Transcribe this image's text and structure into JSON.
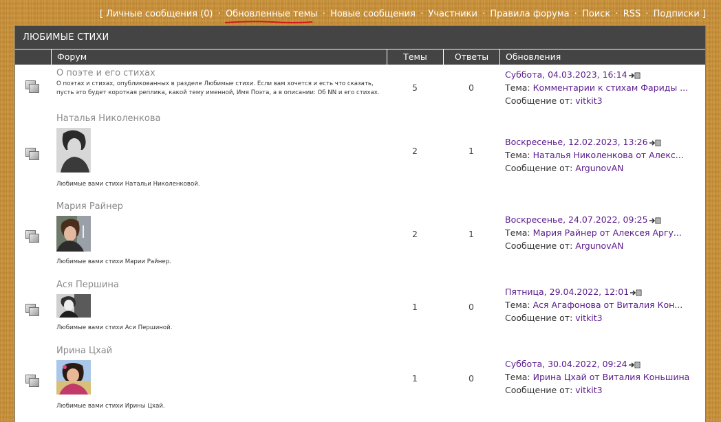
{
  "topnav": {
    "bracket_open": "[",
    "bracket_close": "]",
    "private_messages": "Личные сообщения (0)",
    "updated_topics": "Обновленные темы",
    "new_messages": "Новые сообщения",
    "members": "Участники",
    "rules": "Правила форума",
    "search": "Поиск",
    "rss": "RSS",
    "subscriptions": "Подписки",
    "separator": "·"
  },
  "panel": {
    "title": "ЛЮБИМЫЕ СТИХИ",
    "columns": {
      "forum": "Форум",
      "topics": "Темы",
      "replies": "Ответы",
      "updates": "Обновления"
    }
  },
  "labels": {
    "topic_prefix": "Тема:",
    "message_prefix": "Сообщение от:"
  },
  "rows": [
    {
      "title": "О поэте и его стихах",
      "desc": "О поэтах и стихах, опубликованных в разделе Любимые стихи. Если вам хочется и есть что сказать, пусть это будет короткая реплика, какой тему именной, Имя Поэта, а в описании: Об NN и его стихах.",
      "topics": "5",
      "replies": "0",
      "date": "Суббота, 04.03.2023, 16:14",
      "topic": "Комментарии к стихам Фариды ...",
      "author": "vitkit3"
    },
    {
      "title": "Наталья Николенкова",
      "desc": "Любимые вами стихи Натальи Николенковой.",
      "topics": "2",
      "replies": "1",
      "date": "Воскресенье, 12.02.2023, 13:26",
      "topic": "Наталья Николенкова от Алекс...",
      "author": "ArgunovAN"
    },
    {
      "title": "Мария Райнер",
      "desc": "Любимые вами стихи Марии Райнер.",
      "topics": "2",
      "replies": "1",
      "date": "Воскресенье, 24.07.2022, 09:25",
      "topic": "Мария Райнер от Алексея Аргу...",
      "author": "ArgunovAN"
    },
    {
      "title": "Ася Першина",
      "desc": "Любимые вами стихи Аси Першиной.",
      "topics": "1",
      "replies": "0",
      "date": "Пятница, 29.04.2022, 12:01",
      "topic": "Ася Агафонова от Виталия Кон...",
      "author": "vitkit3"
    },
    {
      "title": "Ирина Цхай",
      "desc": "Любимые вами стихи Ирины Цхай.",
      "topics": "1",
      "replies": "0",
      "date": "Суббота, 30.04.2022, 09:24",
      "topic": "Ирина Цхай от Виталия Коньшина",
      "author": "vitkit3"
    }
  ]
}
